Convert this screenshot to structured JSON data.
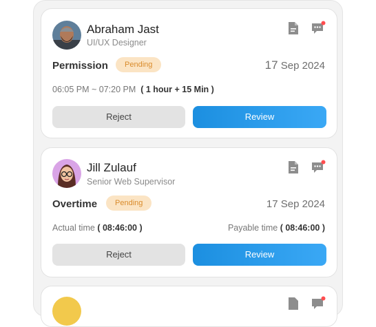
{
  "requests": [
    {
      "name": "Abraham Jast",
      "role": "UI/UX Designer",
      "type": "Permission",
      "status": "Pending",
      "date_day": "17",
      "date_rest": "Sep 2024",
      "time_range": "06:05 PM ~ 07:20 PM",
      "duration": "( 1 hour + 15 Min )",
      "reject_label": "Reject",
      "review_label": "Review"
    },
    {
      "name": "Jill Zulauf",
      "role": "Senior Web Supervisor",
      "type": "Overtime",
      "status": "Pending",
      "date": "17 Sep 2024",
      "actual_label": "Actual time",
      "actual_value": "( 08:46:00 )",
      "payable_label": "Payable time",
      "payable_value": "( 08:46:00 )",
      "reject_label": "Reject",
      "review_label": "Review"
    }
  ],
  "colors": {
    "accent": "#1c8fe0",
    "pending_bg": "#fbe4c4",
    "pending_text": "#d98b2b",
    "notification_dot": "#ff4d4f"
  },
  "icons": [
    "document-icon",
    "chat-icon"
  ]
}
